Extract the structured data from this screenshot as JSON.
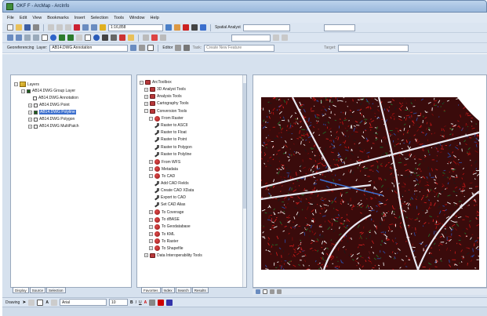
{
  "window": {
    "title": "OKF F - ArcMap - ArcInfo"
  },
  "menu": [
    "File",
    "Edit",
    "View",
    "Bookmarks",
    "Insert",
    "Selection",
    "Tools",
    "Window",
    "Help"
  ],
  "toolbar": {
    "scale": "1:16,858",
    "spatial_analyst": "Spatial Analyst",
    "georeferencing": "Georeferencing",
    "layer_label": "Layer:",
    "layer_value": "AB14.DWG Annotation",
    "editor": "Editor",
    "task": "Task:",
    "create_new_feature": "Create New Feature",
    "target": "Target:"
  },
  "toc": {
    "root": "Layers",
    "group": "AB14.DWG Group Layer",
    "layers": [
      {
        "label": "AB14.DWG Annotation",
        "checked": false,
        "selected": false
      },
      {
        "label": "AB14.DWG Point",
        "checked": false,
        "selected": false
      },
      {
        "label": "AB14.DWG Polyline",
        "checked": true,
        "selected": true
      },
      {
        "label": "AB14.DWG Polygon",
        "checked": false,
        "selected": false
      },
      {
        "label": "AB14.DWG MultiPatch",
        "checked": false,
        "selected": false
      }
    ],
    "tabs": [
      "Display",
      "Source",
      "Selection"
    ]
  },
  "toolbox": {
    "root": "ArcToolbox",
    "items": [
      "3D Analyst Tools",
      "Analysis Tools",
      "Cartography Tools",
      "Conversion Tools",
      "From Raster",
      "Raster to ASCII",
      "Raster to Float",
      "Raster to Point",
      "Raster to Polygon",
      "Raster to Polyline",
      "From WFS",
      "Metadata",
      "To CAD",
      "Add CAD Fields",
      "Create CAD XData",
      "Export to CAD",
      "Set CAD Alias",
      "To Coverage",
      "To dBASE",
      "To Geodatabase",
      "To KML",
      "To Raster",
      "To Shapefile",
      "Data Interoperability Tools"
    ],
    "tabs": [
      "Favorites",
      "Index",
      "Search",
      "Results"
    ]
  },
  "drawing": {
    "label": "Drawing",
    "font": "Arial",
    "size": "10"
  },
  "colors": {
    "selection": "#3a6ecd",
    "map_red": "#b01010",
    "map_road": "#e9e9f2",
    "window_chrome": "#d6e1ee"
  }
}
